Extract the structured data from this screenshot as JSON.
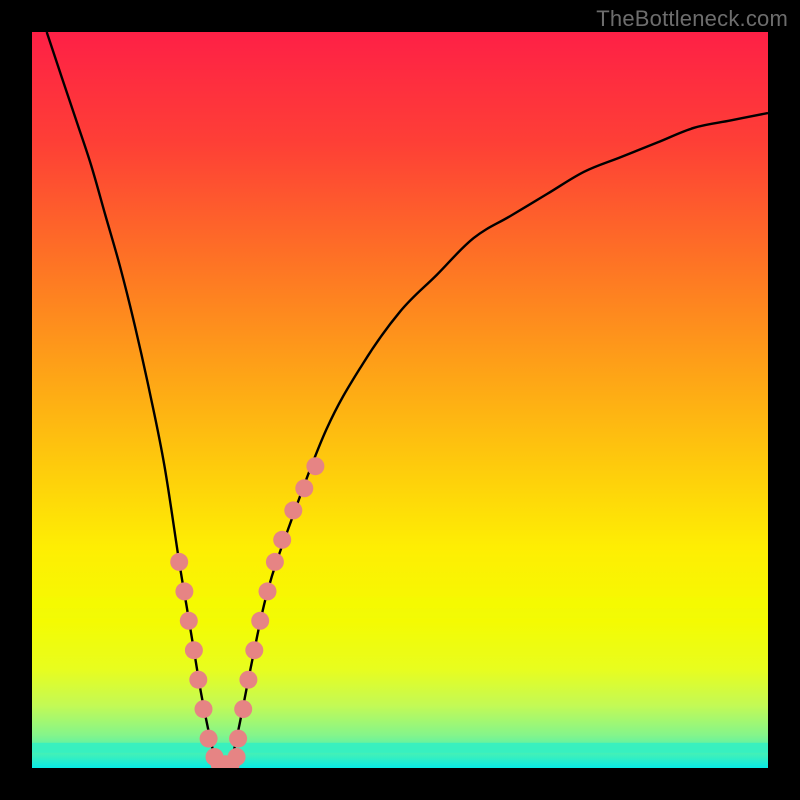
{
  "watermark": "TheBottleneck.com",
  "colors": {
    "gradient_stops": [
      {
        "offset": 0.0,
        "color": "#fe2046"
      },
      {
        "offset": 0.15,
        "color": "#fe3f36"
      },
      {
        "offset": 0.3,
        "color": "#fe6f26"
      },
      {
        "offset": 0.45,
        "color": "#fe9f18"
      },
      {
        "offset": 0.58,
        "color": "#fec80d"
      },
      {
        "offset": 0.7,
        "color": "#feee03"
      },
      {
        "offset": 0.8,
        "color": "#f4fb02"
      },
      {
        "offset": 0.865,
        "color": "#e8fd1e"
      },
      {
        "offset": 0.915,
        "color": "#c3fa55"
      },
      {
        "offset": 0.955,
        "color": "#85f58a"
      },
      {
        "offset": 0.985,
        "color": "#36efc0"
      },
      {
        "offset": 1.0,
        "color": "#08eae6"
      }
    ],
    "highlight_bands": [
      {
        "y": 0.775,
        "color": "#f4fb02",
        "alpha": 0.55
      },
      {
        "y": 0.79,
        "color": "#f0fc08",
        "alpha": 0.55
      },
      {
        "y": 0.9725,
        "color": "#35efc1",
        "alpha": 0.9
      }
    ],
    "curve": "#010000",
    "dots": "#e68484",
    "frame_bg": "#000000",
    "watermark": "#6d6d6d"
  },
  "chart_data": {
    "type": "line",
    "title": "",
    "xlabel": "",
    "ylabel": "",
    "xlim": [
      0,
      100
    ],
    "ylim": [
      0,
      100
    ],
    "series": [
      {
        "name": "bottleneck-curve",
        "x": [
          2,
          4,
          6,
          8,
          10,
          12,
          14,
          16,
          18,
          20,
          21,
          22,
          23,
          24,
          25,
          26,
          27,
          28,
          30,
          32,
          35,
          40,
          45,
          50,
          55,
          60,
          65,
          70,
          75,
          80,
          85,
          90,
          95,
          100
        ],
        "y": [
          100,
          94,
          88,
          82,
          75,
          68,
          60,
          51,
          41,
          28,
          22,
          16,
          10,
          5,
          1,
          0,
          1,
          5,
          15,
          24,
          33,
          46,
          55,
          62,
          67,
          72,
          75,
          78,
          81,
          83,
          85,
          87,
          88,
          89
        ]
      }
    ],
    "annotations": {
      "dotted_left_branch": {
        "name": "highlight-dots-left",
        "points": [
          {
            "x": 20.0,
            "y": 28
          },
          {
            "x": 20.7,
            "y": 24
          },
          {
            "x": 21.3,
            "y": 20
          },
          {
            "x": 22.0,
            "y": 16
          },
          {
            "x": 22.6,
            "y": 12
          },
          {
            "x": 23.3,
            "y": 8
          },
          {
            "x": 24.0,
            "y": 4
          },
          {
            "x": 24.8,
            "y": 1.5
          },
          {
            "x": 25.5,
            "y": 0.5
          },
          {
            "x": 26.3,
            "y": 0.5
          },
          {
            "x": 27.0,
            "y": 0.5
          }
        ]
      },
      "dotted_right_branch": {
        "name": "highlight-dots-right",
        "points": [
          {
            "x": 27.8,
            "y": 1.5
          },
          {
            "x": 28.0,
            "y": 4
          },
          {
            "x": 28.7,
            "y": 8
          },
          {
            "x": 29.4,
            "y": 12
          },
          {
            "x": 30.2,
            "y": 16
          },
          {
            "x": 31.0,
            "y": 20
          },
          {
            "x": 32.0,
            "y": 24
          },
          {
            "x": 33.0,
            "y": 28
          },
          {
            "x": 34.0,
            "y": 31
          },
          {
            "x": 35.5,
            "y": 35
          },
          {
            "x": 37.0,
            "y": 38
          },
          {
            "x": 38.5,
            "y": 41
          }
        ]
      }
    },
    "notes": "x and y are in percent of the plot area (0–100). y=0 is the bottom (green) edge; y=100 is the top (red) edge. The curve is an approximate V shape bottoming near x≈26. Values are estimated from pixel positions; the source image has no numeric axes."
  }
}
